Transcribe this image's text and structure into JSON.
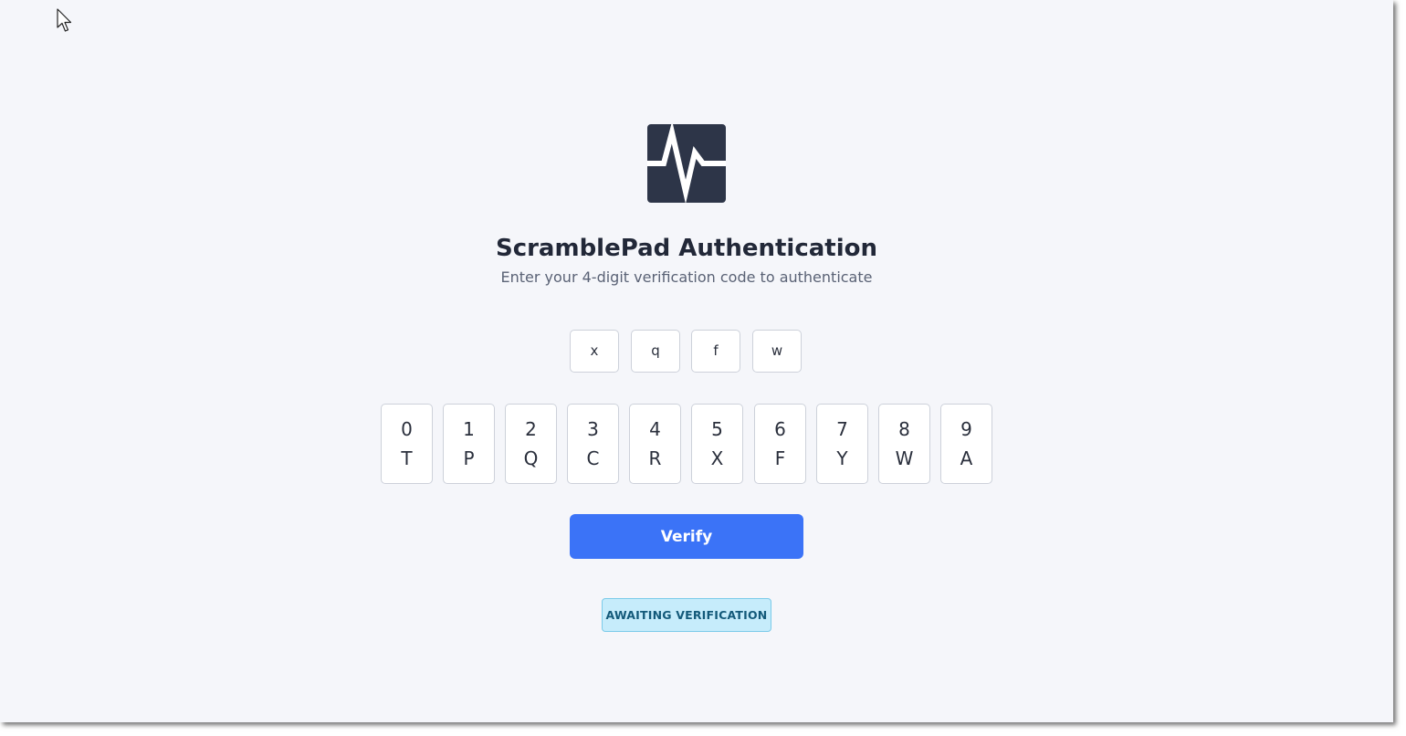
{
  "app": {
    "logo_icon": "heartbeat-pulse-icon",
    "title": "ScramblePad Authentication",
    "subtitle": "Enter your 4-digit verification code to authenticate"
  },
  "code": [
    "x",
    "q",
    "f",
    "w"
  ],
  "keypad": [
    {
      "digit": "0",
      "letter": "T"
    },
    {
      "digit": "1",
      "letter": "P"
    },
    {
      "digit": "2",
      "letter": "Q"
    },
    {
      "digit": "3",
      "letter": "C"
    },
    {
      "digit": "4",
      "letter": "R"
    },
    {
      "digit": "5",
      "letter": "X"
    },
    {
      "digit": "6",
      "letter": "F"
    },
    {
      "digit": "7",
      "letter": "Y"
    },
    {
      "digit": "8",
      "letter": "W"
    },
    {
      "digit": "9",
      "letter": "A"
    }
  ],
  "verify_label": "Verify",
  "status": "AWAITING VERIFICATION",
  "colors": {
    "background": "#f5f6fa",
    "logo": "#2d3548",
    "accent": "#3b73f7",
    "status_bg": "#c6ecfb",
    "status_text": "#145a7a"
  }
}
